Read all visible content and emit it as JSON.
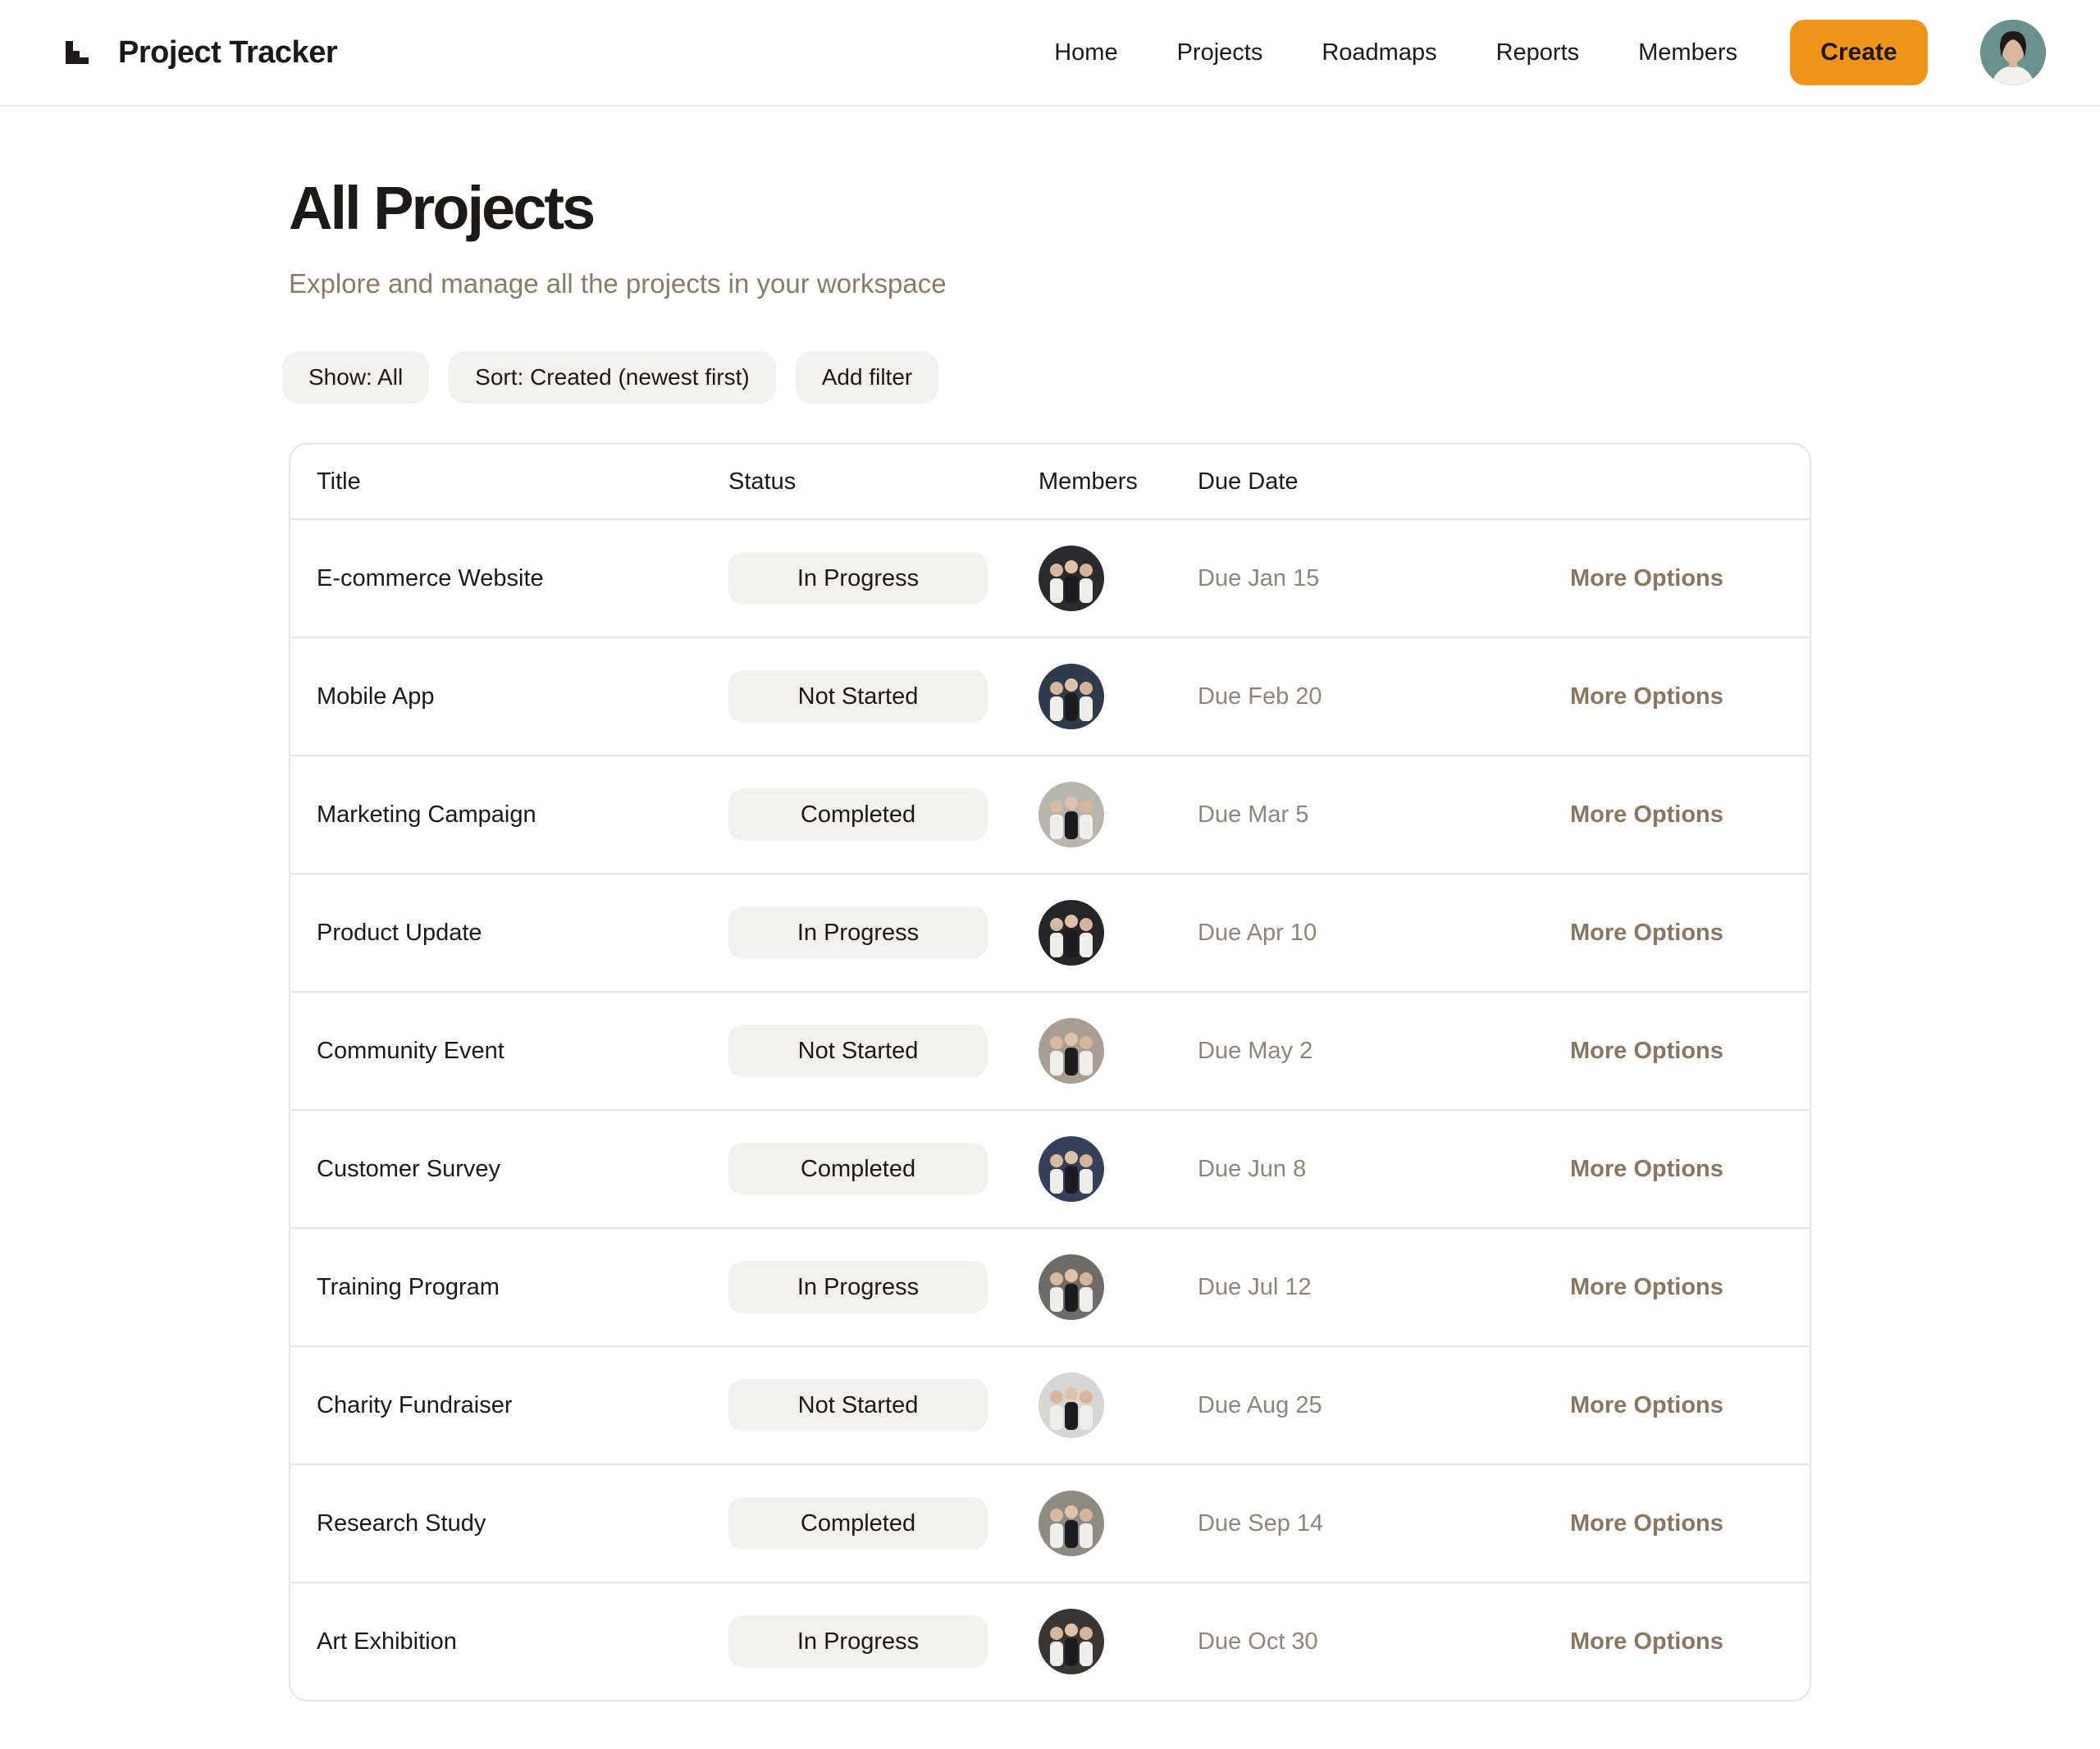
{
  "app": {
    "name": "Project Tracker"
  },
  "nav": {
    "links": [
      "Home",
      "Projects",
      "Roadmaps",
      "Reports",
      "Members"
    ],
    "create_label": "Create"
  },
  "page": {
    "title": "All Projects",
    "subtitle": "Explore and manage all the projects in your workspace"
  },
  "filters": {
    "show": "Show: All",
    "sort": "Sort: Created (newest first)",
    "add": "Add filter"
  },
  "table": {
    "headers": {
      "title": "Title",
      "status": "Status",
      "members": "Members",
      "due": "Due Date"
    },
    "more_label": "More Options",
    "rows": [
      {
        "title": "E-commerce Website",
        "status": "In Progress",
        "due": "Due Jan 15",
        "bg": "#2b2a2e"
      },
      {
        "title": "Mobile App",
        "status": "Not Started",
        "due": "Due Feb 20",
        "bg": "#2f3b4a"
      },
      {
        "title": "Marketing Campaign",
        "status": "Completed",
        "due": "Due Mar 5",
        "bg": "#b8b4ae"
      },
      {
        "title": "Product Update",
        "status": "In Progress",
        "due": "Due Apr 10",
        "bg": "#26262a"
      },
      {
        "title": "Community Event",
        "status": "Not Started",
        "due": "Due May 2",
        "bg": "#a89e94"
      },
      {
        "title": "Customer Survey",
        "status": "Completed",
        "due": "Due Jun 8",
        "bg": "#37405a"
      },
      {
        "title": "Training Program",
        "status": "In Progress",
        "due": "Due Jul 12",
        "bg": "#6f6c68"
      },
      {
        "title": "Charity Fundraiser",
        "status": "Not Started",
        "due": "Due Aug 25",
        "bg": "#d8d6d2"
      },
      {
        "title": "Research Study",
        "status": "Completed",
        "due": "Due Sep 14",
        "bg": "#8f8a82"
      },
      {
        "title": "Art Exhibition",
        "status": "In Progress",
        "due": "Due Oct 30",
        "bg": "#3a3634"
      }
    ]
  },
  "colors": {
    "accent": "#ef9418",
    "chip_bg": "#f3f1ee",
    "muted_text": "#8a7a68"
  }
}
